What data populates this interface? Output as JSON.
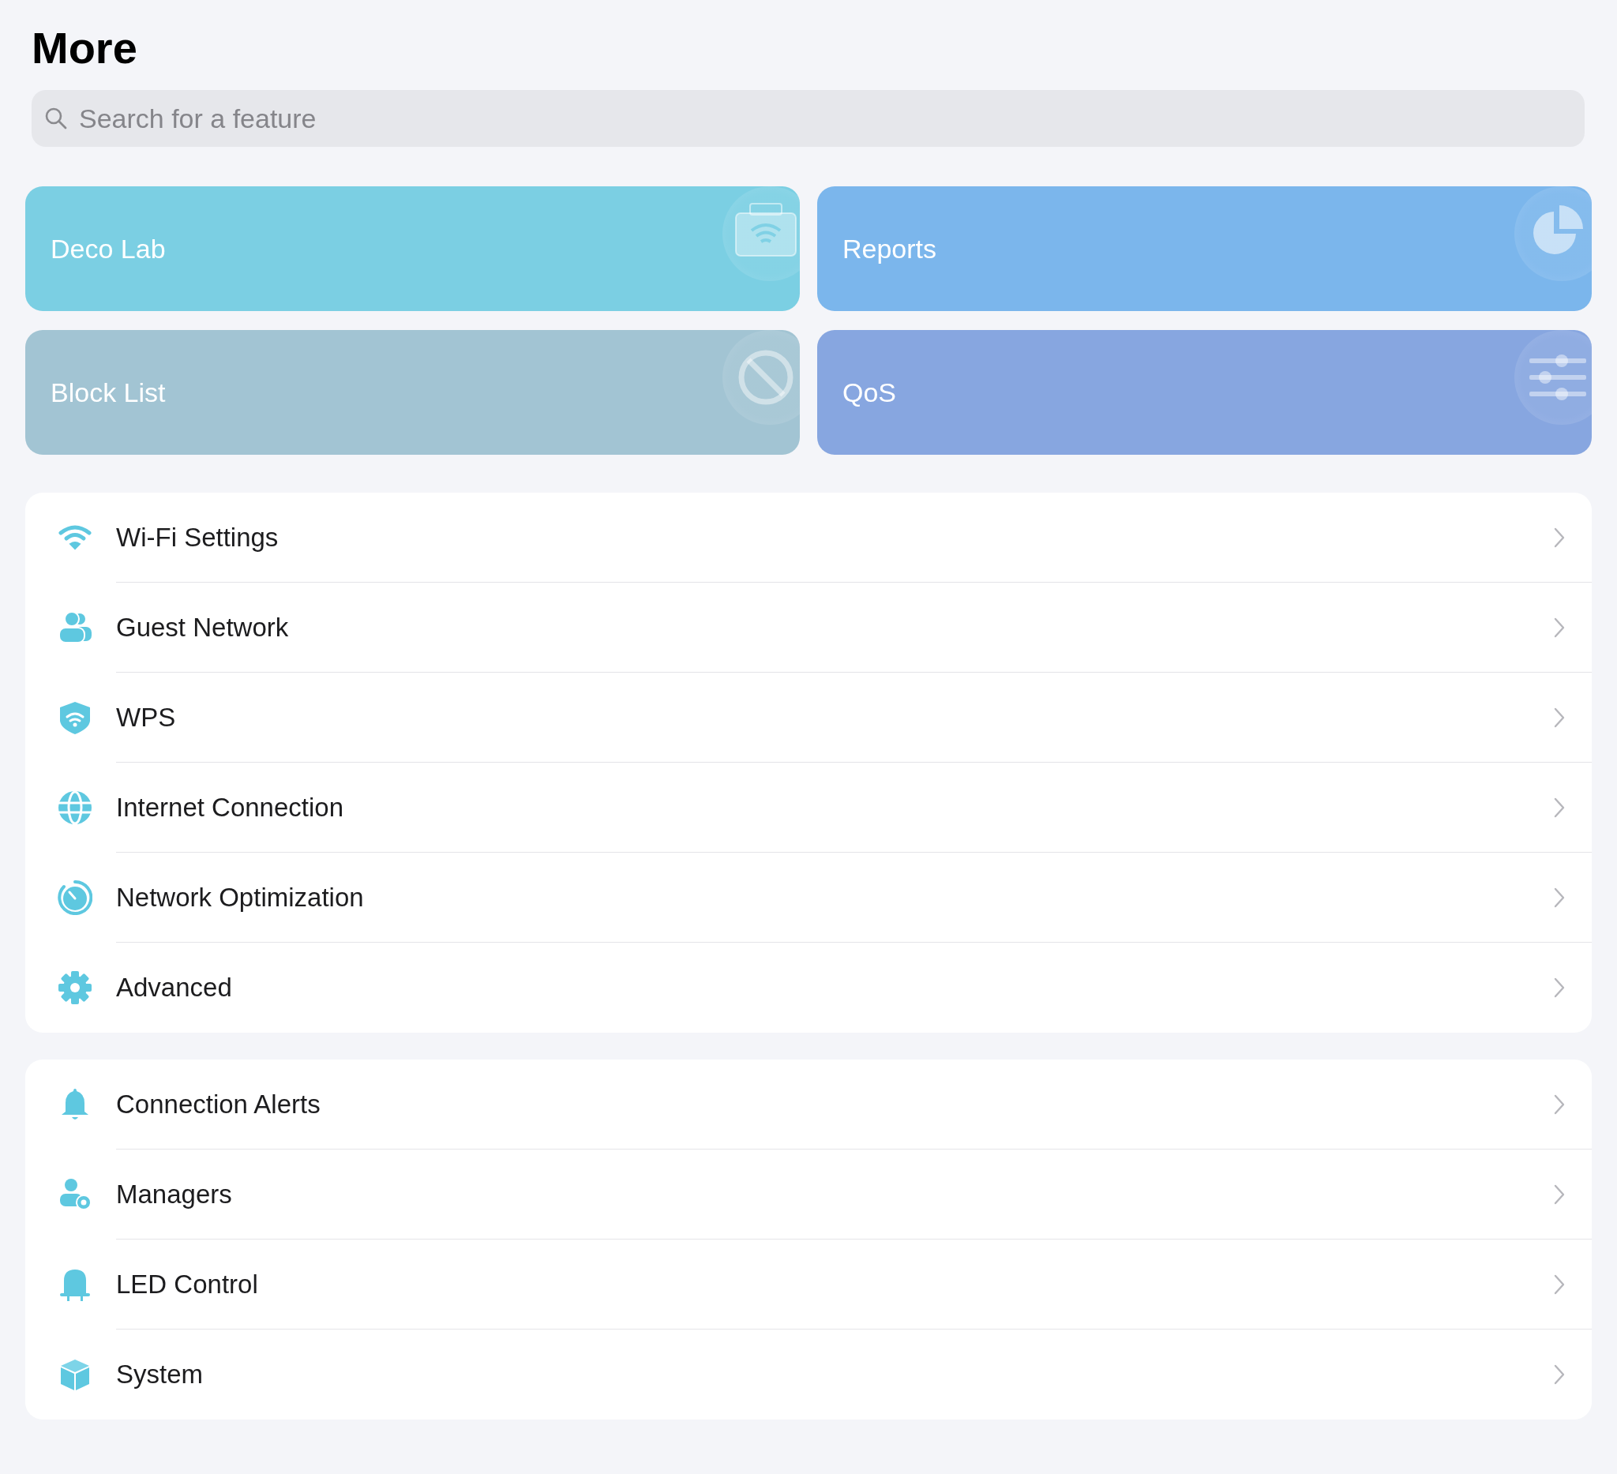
{
  "title": "More",
  "search": {
    "placeholder": "Search for a feature"
  },
  "tiles": [
    {
      "label": "Deco Lab",
      "kind": "lab",
      "color": "#7bcfe3"
    },
    {
      "label": "Reports",
      "kind": "reports",
      "color": "#7bb6ec"
    },
    {
      "label": "Block List",
      "kind": "block",
      "color": "#a2c4d3"
    },
    {
      "label": "QoS",
      "kind": "qos",
      "color": "#87a6e0"
    }
  ],
  "groups": [
    {
      "items": [
        {
          "label": "Wi-Fi Settings",
          "kind": "wifi"
        },
        {
          "label": "Guest Network",
          "kind": "guests"
        },
        {
          "label": "WPS",
          "kind": "shield"
        },
        {
          "label": "Internet Connection",
          "kind": "globe"
        },
        {
          "label": "Network Optimization",
          "kind": "gauge"
        },
        {
          "label": "Advanced",
          "kind": "gear"
        }
      ]
    },
    {
      "items": [
        {
          "label": "Connection Alerts",
          "kind": "bell"
        },
        {
          "label": "Managers",
          "kind": "manager"
        },
        {
          "label": "LED Control",
          "kind": "led"
        },
        {
          "label": "System",
          "kind": "cube"
        }
      ]
    }
  ]
}
